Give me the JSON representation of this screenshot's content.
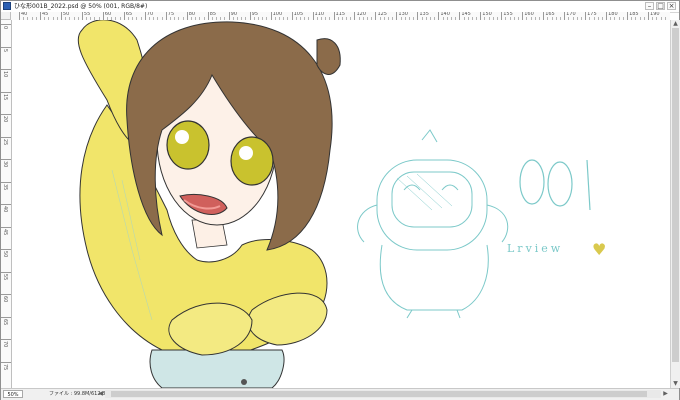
{
  "window": {
    "title": "ひな形001B_2022.psd @ 50% (001, RGB/8#)",
    "controls": {
      "minimize": "–",
      "maximize": "□",
      "close": "×"
    }
  },
  "ruler": {
    "horizontal_labels": [
      "40",
      "45",
      "50",
      "55",
      "60",
      "65",
      "70",
      "75",
      "80",
      "85",
      "90",
      "95",
      "100",
      "105",
      "110",
      "115",
      "120",
      "125",
      "130",
      "135",
      "140",
      "145",
      "150",
      "155",
      "160",
      "165",
      "170",
      "175",
      "180",
      "185",
      "190"
    ],
    "vertical_labels": [
      "0",
      "5",
      "10",
      "15",
      "20",
      "25",
      "30",
      "35",
      "40",
      "45",
      "50",
      "55",
      "60",
      "65",
      "70",
      "75"
    ]
  },
  "canvas": {
    "artwork_text": "001",
    "artwork_signature": "Lrview",
    "artwork_heart": "♥"
  },
  "status": {
    "zoom": "50%",
    "doc_size": "ファイル : 99.8M/612.8M"
  },
  "scroll": {
    "vertical_position": 0.0,
    "vertical_visible": 0.95,
    "horizontal_position": 0.01,
    "horizontal_visible": 0.965
  },
  "colors": {
    "sketch_line": "#7cc9c9",
    "hair": "#8b6b4a",
    "shirt": "#f1e56a",
    "eyes": "#c9c22e"
  },
  "icons": {
    "app": "photoshop-icon",
    "scroll_up": "arrow-up-icon",
    "scroll_down": "arrow-down-icon",
    "scroll_left": "arrow-left-icon",
    "scroll_right": "arrow-right-icon"
  }
}
